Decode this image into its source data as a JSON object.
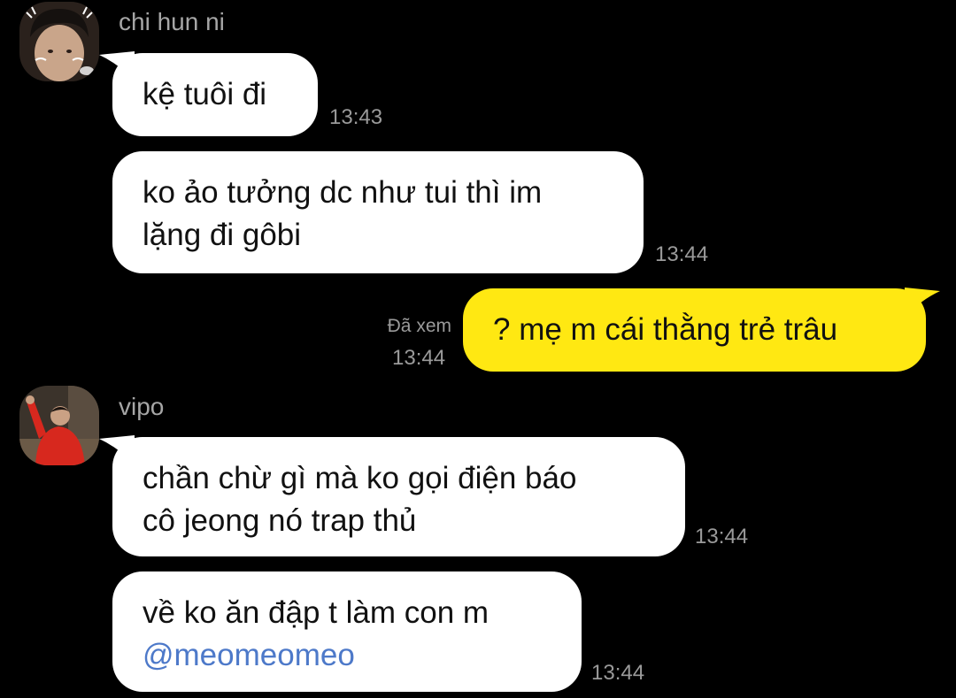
{
  "colors": {
    "background": "#000000",
    "incoming_bubble": "#ffffff",
    "outgoing_bubble": "#ffe812",
    "mention": "#4d79c9",
    "meta_text": "#9a9a9a"
  },
  "messages": [
    {
      "sender": "chi hun ni",
      "avatar": "avatar-photo-chi-hun-ni",
      "text_lines": [
        "kệ tuôi đi"
      ],
      "time": "13:43"
    },
    {
      "text_lines": [
        "ko ảo tưởng dc như tui thì im",
        "lặng đi gôbi"
      ],
      "time": "13:44"
    },
    {
      "outgoing": true,
      "text_lines": [
        "? mẹ m cái thằng trẻ trâu"
      ],
      "status": "Đã xem",
      "time": "13:44"
    },
    {
      "sender": "vipo",
      "avatar": "avatar-photo-vipo",
      "text_lines": [
        "chần chừ gì mà ko gọi điện báo",
        "cô jeong nó trap thủ"
      ],
      "time": "13:44"
    },
    {
      "text_lines": [
        "về ko ăn đập t làm con m"
      ],
      "mention": "@meomeomeo",
      "time": "13:44"
    }
  ]
}
